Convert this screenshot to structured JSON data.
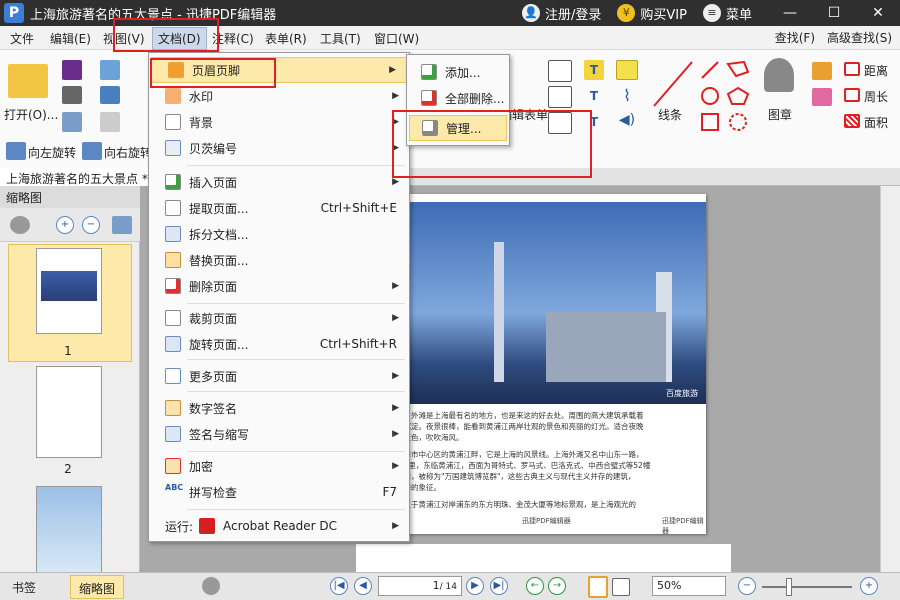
{
  "app": {
    "title": "上海旅游著名的五大景点 - 迅捷PDF编辑器",
    "logo": "P",
    "register": "注册/登录",
    "buy_vip": "购买VIP",
    "menu": "菜单"
  },
  "menubar": {
    "items": [
      "文件",
      "编辑(E)",
      "视图(V)",
      "文档(D)",
      "注释(C)",
      "表单(R)",
      "工具(T)",
      "窗口(W)"
    ],
    "right": [
      "查找(F)",
      "高级查找(S)"
    ]
  },
  "ribbon": {
    "open": "打开(O)...",
    "rotate_left": "向左旋转",
    "rotate_right": "向右旋转",
    "form": "编辑表单",
    "line": "线条",
    "stamp": "图章",
    "distance": "距离",
    "perimeter": "周长",
    "area": "面积"
  },
  "doc_tab": "上海旅游著名的五大景点 *",
  "thumb_panel": {
    "title": "缩略图",
    "pages": [
      "1",
      "2"
    ]
  },
  "doc_menu": {
    "items": [
      {
        "label": "页眉页脚",
        "has_sub": true
      },
      {
        "label": "水印",
        "has_sub": true
      },
      {
        "label": "背景",
        "has_sub": true
      },
      {
        "label": "贝茨编号",
        "has_sub": true
      },
      {
        "label": "插入页面",
        "has_sub": true
      },
      {
        "label": "提取页面...",
        "shortcut": "Ctrl+Shift+E"
      },
      {
        "label": "拆分文档..."
      },
      {
        "label": "替换页面..."
      },
      {
        "label": "删除页面",
        "has_sub": true
      },
      {
        "label": "裁剪页面",
        "has_sub": true
      },
      {
        "label": "旋转页面...",
        "shortcut": "Ctrl+Shift+R"
      },
      {
        "label": "更多页面",
        "has_sub": true
      },
      {
        "label": "数字签名",
        "has_sub": true
      },
      {
        "label": "签名与缩写",
        "has_sub": true
      },
      {
        "label": "加密",
        "has_sub": true
      },
      {
        "label": "拼写检查",
        "shortcut": "F7"
      }
    ],
    "run_label": "运行:",
    "run_app": "Acrobat Reader DC"
  },
  "submenu": {
    "items": [
      "添加...",
      "全部删除...",
      "管理..."
    ]
  },
  "page_content": {
    "watermark": "百度旅游",
    "footer_left": "迅捷PDF编辑器",
    "footer_right": "迅捷PDF编辑器",
    "p1": "景：外滩是上海最有名的地方，也是来这的好去处。周围的高大建筑承载着",
    "p1b": "的沉淀。夜景很棒，能看到黄浦江两岸壮观的景色和亮丽的灯光。适合夜晚",
    "p1c": "看夜色，吹吹海风。",
    "p2": "上海市中心区的黄浦江畔，它是上海的风景线。上海外滩又名中山东一路，",
    "p2b": "5公里，东临黄浦江，西面为哥特式、罗马式、巴洛克式、中西合璧式等52幢",
    "p2c": "大楼，被称为\"万国建筑博览群\"，这些古典主义与现代主义并存的建筑，",
    "p2d": "上海的象征。",
    "p3": "还位于黄浦江对岸浦东的东方明珠、金茂大厦等地标景观，是上海观光的"
  },
  "bottom": {
    "tab_bookmark": "书签",
    "tab_thumb": "缩略图",
    "page_current": "1",
    "page_total": "/ 14",
    "zoom": "50%"
  },
  "colors": {
    "title_bg": "#2f2f2f",
    "highlight": "#fde9a9",
    "annotation_red": "#e02020",
    "accent_blue": "#2a5aa0"
  }
}
